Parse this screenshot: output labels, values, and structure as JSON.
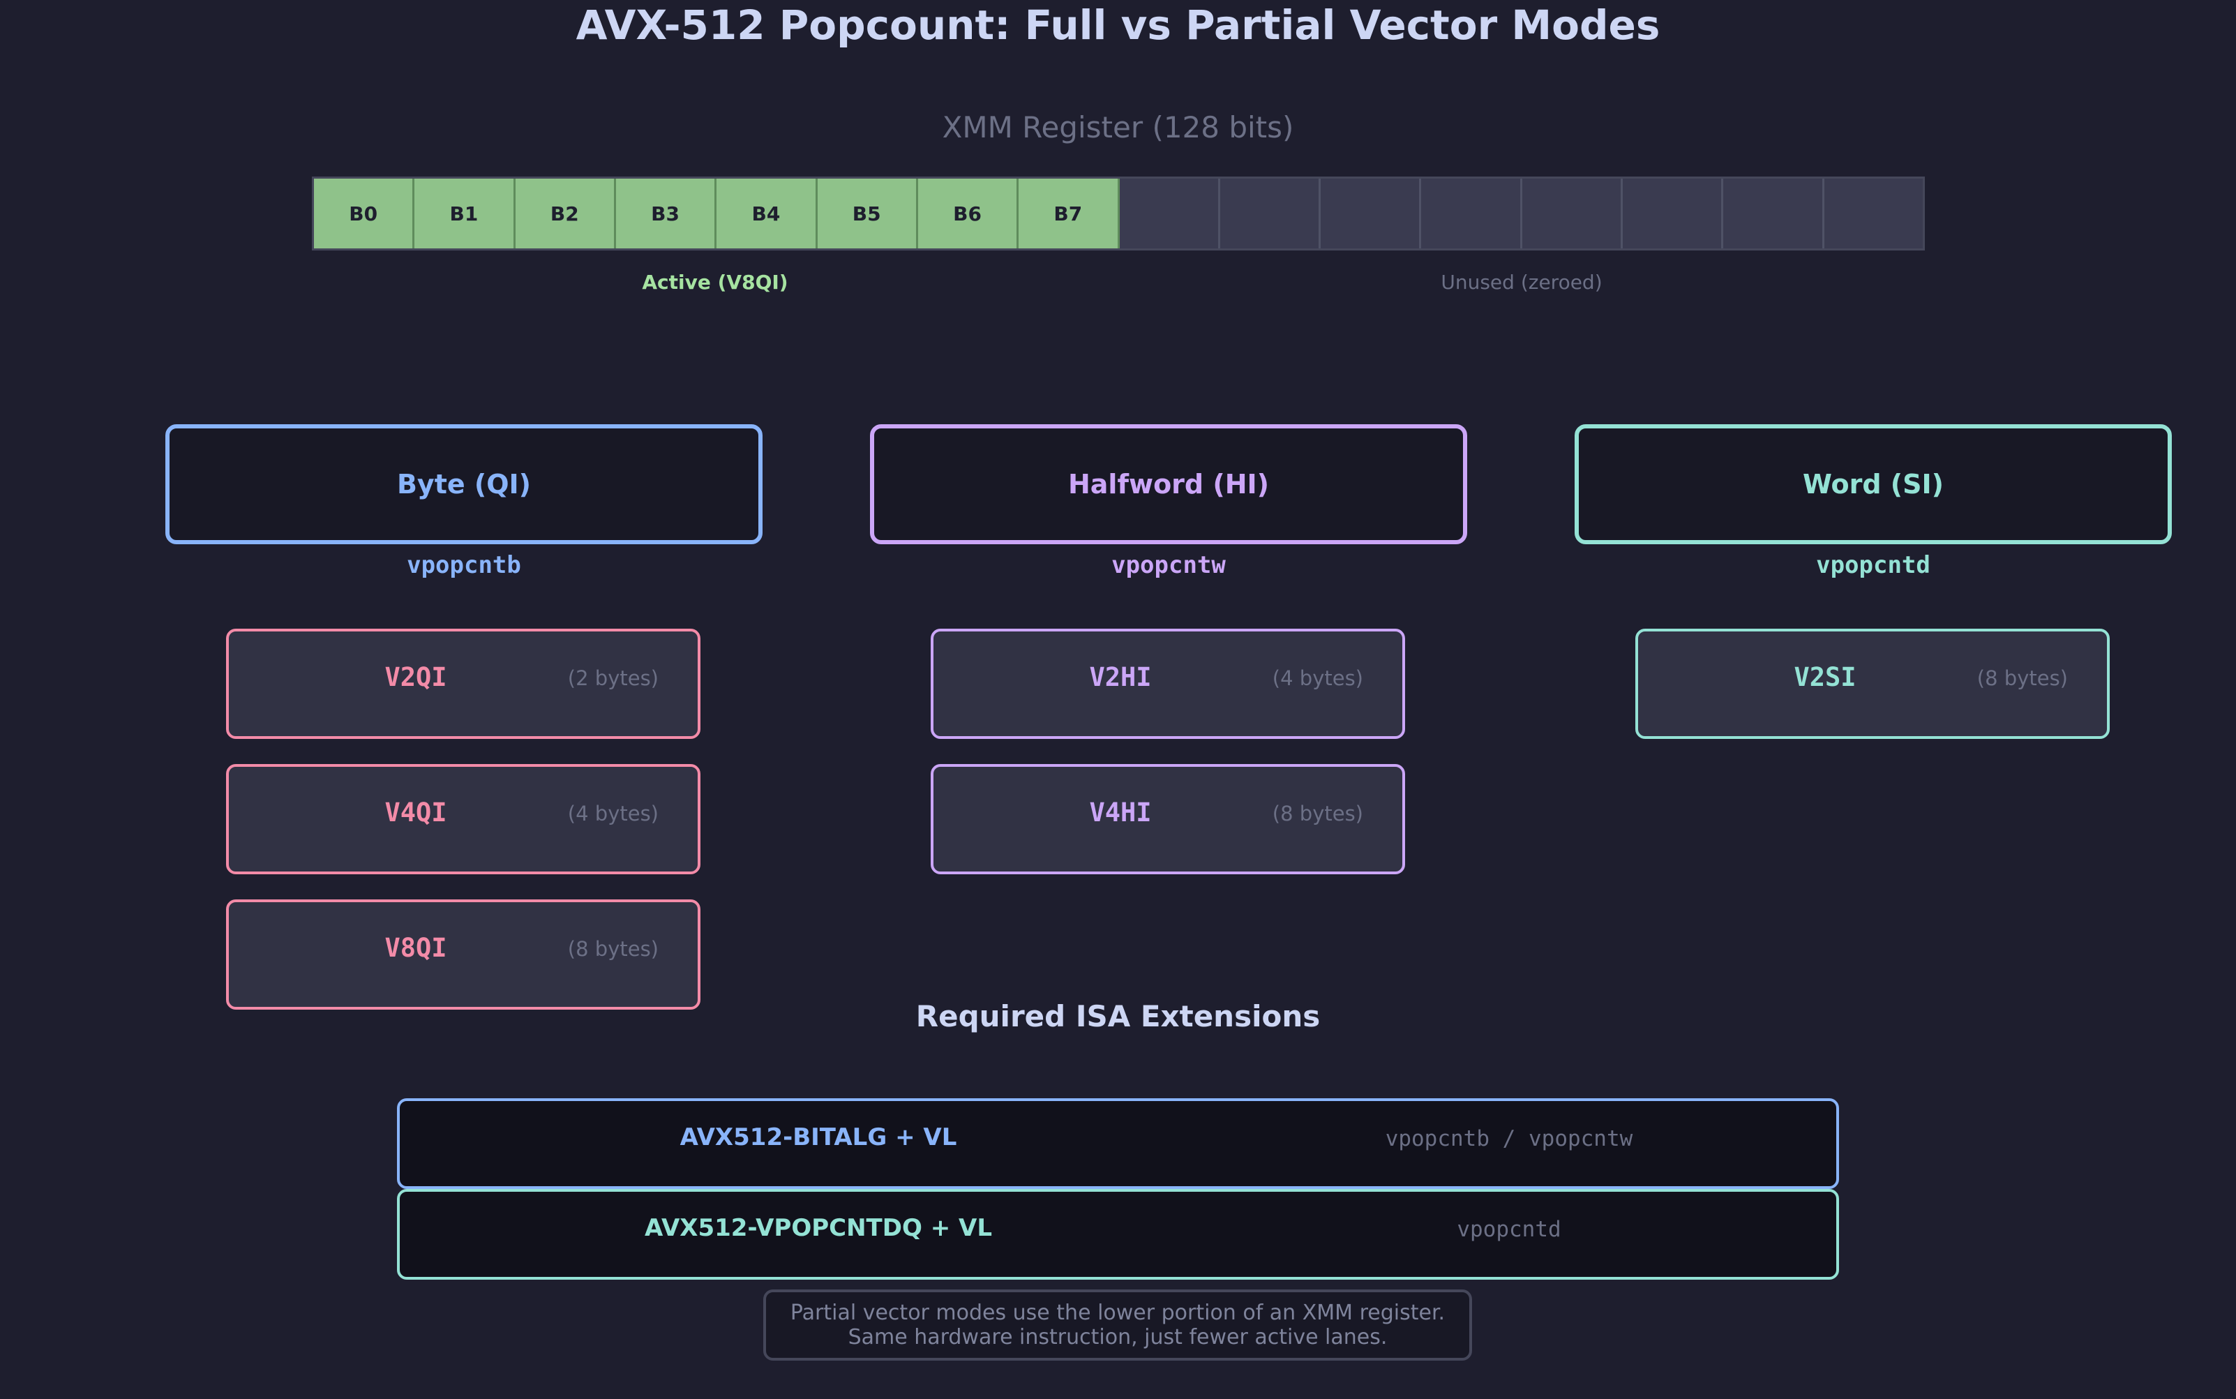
{
  "title": "AVX-512 Popcount: Full vs Partial Vector Modes",
  "register": {
    "title": "XMM Register (128 bits)",
    "active_lanes": [
      "B0",
      "B1",
      "B2",
      "B3",
      "B4",
      "B5",
      "B6",
      "B7"
    ],
    "unused_lane_count": 8,
    "active_label": "Active (V8QI)",
    "unused_label": "Unused (zeroed)"
  },
  "categories": [
    {
      "name": "Byte (QI)",
      "instruction": "vpopcntb",
      "color": "#89b4fa",
      "mode_color": "#f38ba8",
      "modes": [
        {
          "name": "V2QI",
          "size": "(2 bytes)"
        },
        {
          "name": "V4QI",
          "size": "(4 bytes)"
        },
        {
          "name": "V8QI",
          "size": "(8 bytes)"
        }
      ]
    },
    {
      "name": "Halfword (HI)",
      "instruction": "vpopcntw",
      "color": "#cba6f7",
      "mode_color": "#cba6f7",
      "modes": [
        {
          "name": "V2HI",
          "size": "(4 bytes)"
        },
        {
          "name": "V4HI",
          "size": "(8 bytes)"
        }
      ]
    },
    {
      "name": "Word (SI)",
      "instruction": "vpopcntd",
      "color": "#94e2d5",
      "mode_color": "#94e2d5",
      "modes": [
        {
          "name": "V2SI",
          "size": "(8 bytes)"
        }
      ]
    }
  ],
  "isa": {
    "title": "Required ISA Extensions",
    "extensions": [
      {
        "name": "AVX512-BITALG + VL",
        "instructions": "vpopcntb / vpopcntw",
        "color": "#89b4fa"
      },
      {
        "name": "AVX512-VPOPCNTDQ + VL",
        "instructions": "vpopcntd",
        "color": "#94e2d5"
      }
    ]
  },
  "note": {
    "line1": "Partial vector modes use the lower portion of an XMM register.",
    "line2": "Same hardware instruction, just fewer active lanes."
  }
}
